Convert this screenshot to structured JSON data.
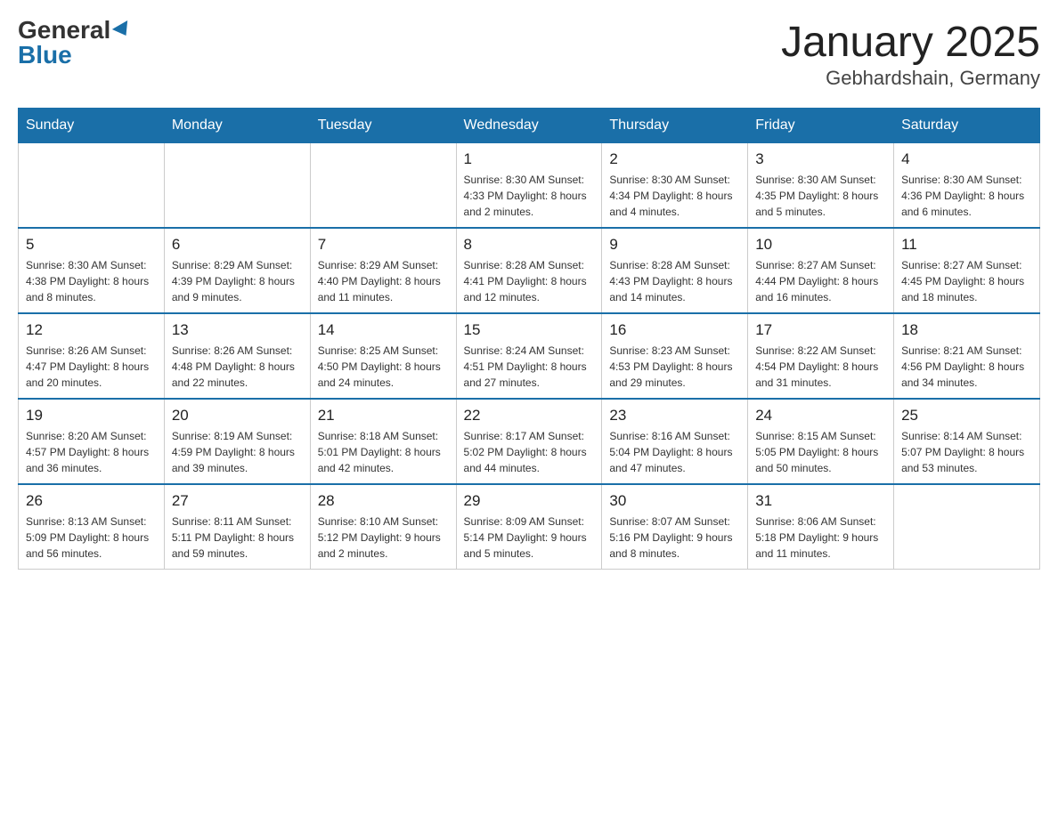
{
  "header": {
    "logo_general": "General",
    "logo_blue": "Blue",
    "month_title": "January 2025",
    "location": "Gebhardshain, Germany"
  },
  "days_of_week": [
    "Sunday",
    "Monday",
    "Tuesday",
    "Wednesday",
    "Thursday",
    "Friday",
    "Saturday"
  ],
  "weeks": [
    {
      "days": [
        {
          "number": "",
          "info": ""
        },
        {
          "number": "",
          "info": ""
        },
        {
          "number": "",
          "info": ""
        },
        {
          "number": "1",
          "info": "Sunrise: 8:30 AM\nSunset: 4:33 PM\nDaylight: 8 hours\nand 2 minutes."
        },
        {
          "number": "2",
          "info": "Sunrise: 8:30 AM\nSunset: 4:34 PM\nDaylight: 8 hours\nand 4 minutes."
        },
        {
          "number": "3",
          "info": "Sunrise: 8:30 AM\nSunset: 4:35 PM\nDaylight: 8 hours\nand 5 minutes."
        },
        {
          "number": "4",
          "info": "Sunrise: 8:30 AM\nSunset: 4:36 PM\nDaylight: 8 hours\nand 6 minutes."
        }
      ]
    },
    {
      "days": [
        {
          "number": "5",
          "info": "Sunrise: 8:30 AM\nSunset: 4:38 PM\nDaylight: 8 hours\nand 8 minutes."
        },
        {
          "number": "6",
          "info": "Sunrise: 8:29 AM\nSunset: 4:39 PM\nDaylight: 8 hours\nand 9 minutes."
        },
        {
          "number": "7",
          "info": "Sunrise: 8:29 AM\nSunset: 4:40 PM\nDaylight: 8 hours\nand 11 minutes."
        },
        {
          "number": "8",
          "info": "Sunrise: 8:28 AM\nSunset: 4:41 PM\nDaylight: 8 hours\nand 12 minutes."
        },
        {
          "number": "9",
          "info": "Sunrise: 8:28 AM\nSunset: 4:43 PM\nDaylight: 8 hours\nand 14 minutes."
        },
        {
          "number": "10",
          "info": "Sunrise: 8:27 AM\nSunset: 4:44 PM\nDaylight: 8 hours\nand 16 minutes."
        },
        {
          "number": "11",
          "info": "Sunrise: 8:27 AM\nSunset: 4:45 PM\nDaylight: 8 hours\nand 18 minutes."
        }
      ]
    },
    {
      "days": [
        {
          "number": "12",
          "info": "Sunrise: 8:26 AM\nSunset: 4:47 PM\nDaylight: 8 hours\nand 20 minutes."
        },
        {
          "number": "13",
          "info": "Sunrise: 8:26 AM\nSunset: 4:48 PM\nDaylight: 8 hours\nand 22 minutes."
        },
        {
          "number": "14",
          "info": "Sunrise: 8:25 AM\nSunset: 4:50 PM\nDaylight: 8 hours\nand 24 minutes."
        },
        {
          "number": "15",
          "info": "Sunrise: 8:24 AM\nSunset: 4:51 PM\nDaylight: 8 hours\nand 27 minutes."
        },
        {
          "number": "16",
          "info": "Sunrise: 8:23 AM\nSunset: 4:53 PM\nDaylight: 8 hours\nand 29 minutes."
        },
        {
          "number": "17",
          "info": "Sunrise: 8:22 AM\nSunset: 4:54 PM\nDaylight: 8 hours\nand 31 minutes."
        },
        {
          "number": "18",
          "info": "Sunrise: 8:21 AM\nSunset: 4:56 PM\nDaylight: 8 hours\nand 34 minutes."
        }
      ]
    },
    {
      "days": [
        {
          "number": "19",
          "info": "Sunrise: 8:20 AM\nSunset: 4:57 PM\nDaylight: 8 hours\nand 36 minutes."
        },
        {
          "number": "20",
          "info": "Sunrise: 8:19 AM\nSunset: 4:59 PM\nDaylight: 8 hours\nand 39 minutes."
        },
        {
          "number": "21",
          "info": "Sunrise: 8:18 AM\nSunset: 5:01 PM\nDaylight: 8 hours\nand 42 minutes."
        },
        {
          "number": "22",
          "info": "Sunrise: 8:17 AM\nSunset: 5:02 PM\nDaylight: 8 hours\nand 44 minutes."
        },
        {
          "number": "23",
          "info": "Sunrise: 8:16 AM\nSunset: 5:04 PM\nDaylight: 8 hours\nand 47 minutes."
        },
        {
          "number": "24",
          "info": "Sunrise: 8:15 AM\nSunset: 5:05 PM\nDaylight: 8 hours\nand 50 minutes."
        },
        {
          "number": "25",
          "info": "Sunrise: 8:14 AM\nSunset: 5:07 PM\nDaylight: 8 hours\nand 53 minutes."
        }
      ]
    },
    {
      "days": [
        {
          "number": "26",
          "info": "Sunrise: 8:13 AM\nSunset: 5:09 PM\nDaylight: 8 hours\nand 56 minutes."
        },
        {
          "number": "27",
          "info": "Sunrise: 8:11 AM\nSunset: 5:11 PM\nDaylight: 8 hours\nand 59 minutes."
        },
        {
          "number": "28",
          "info": "Sunrise: 8:10 AM\nSunset: 5:12 PM\nDaylight: 9 hours\nand 2 minutes."
        },
        {
          "number": "29",
          "info": "Sunrise: 8:09 AM\nSunset: 5:14 PM\nDaylight: 9 hours\nand 5 minutes."
        },
        {
          "number": "30",
          "info": "Sunrise: 8:07 AM\nSunset: 5:16 PM\nDaylight: 9 hours\nand 8 minutes."
        },
        {
          "number": "31",
          "info": "Sunrise: 8:06 AM\nSunset: 5:18 PM\nDaylight: 9 hours\nand 11 minutes."
        },
        {
          "number": "",
          "info": ""
        }
      ]
    }
  ]
}
